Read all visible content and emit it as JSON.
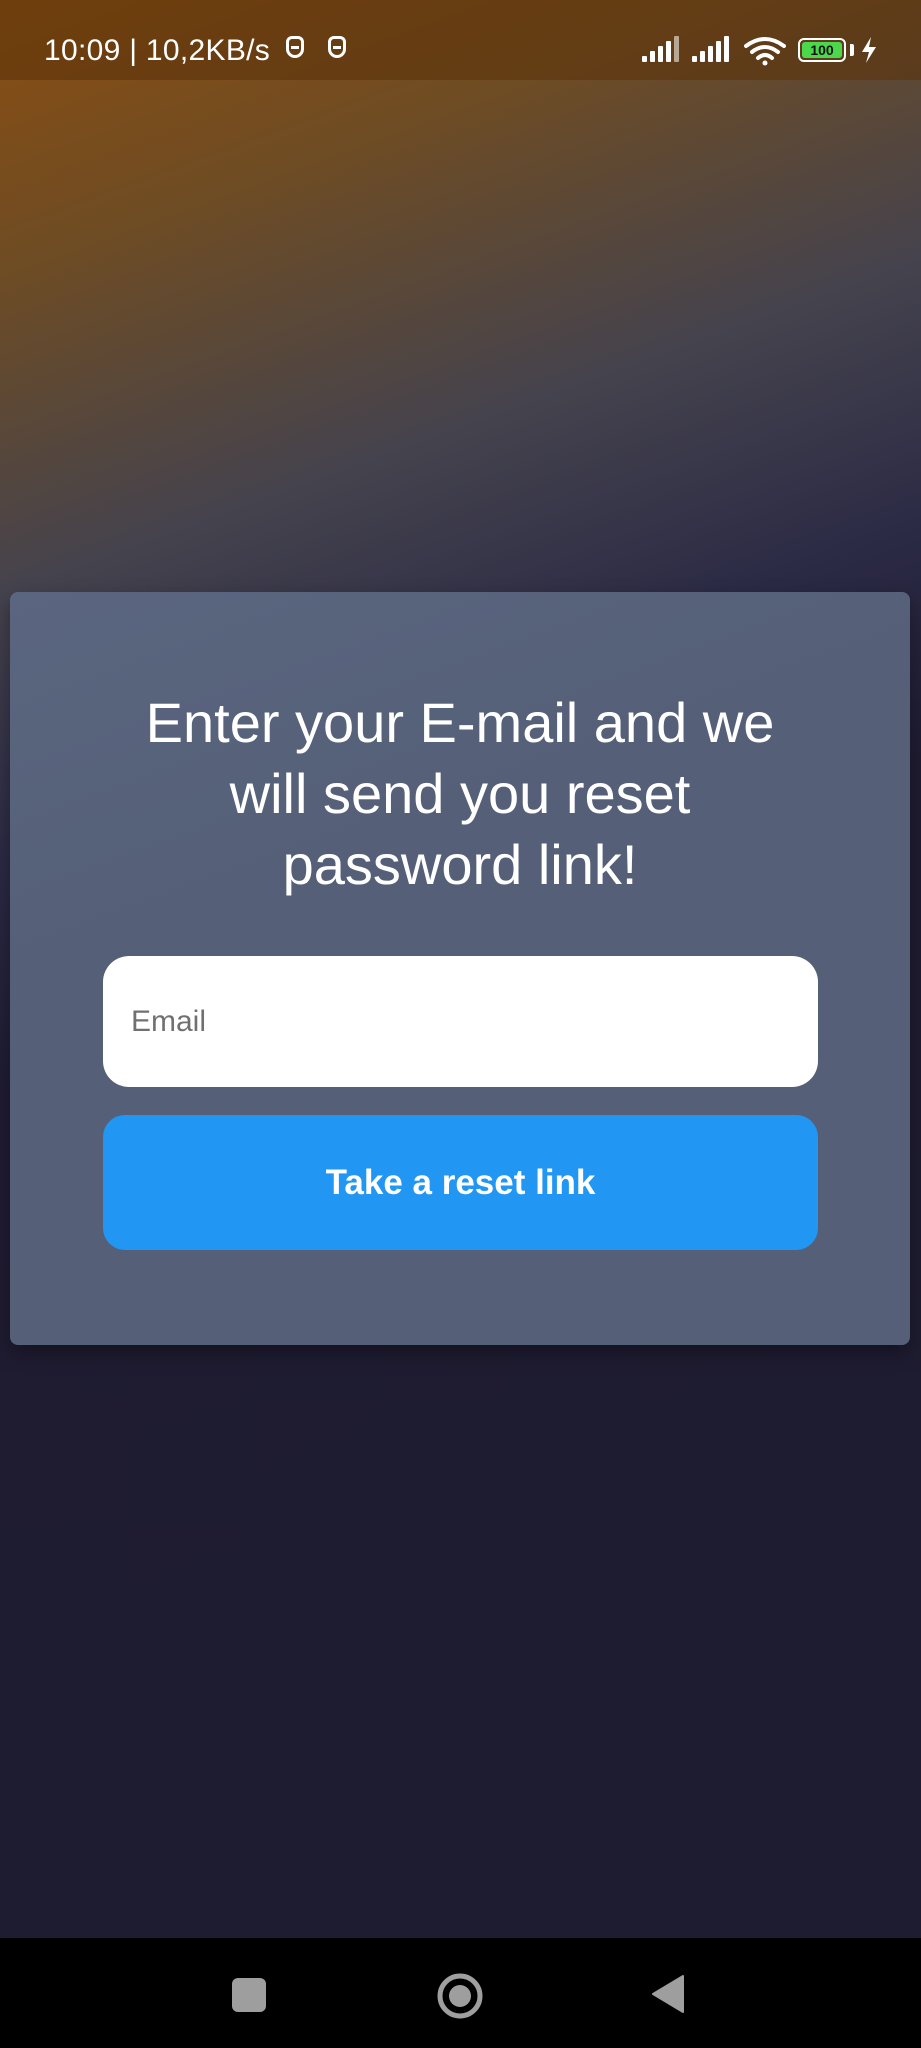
{
  "status_bar": {
    "time_speed": "10:09 | 10,2KB/s",
    "battery_level": "100",
    "icons": [
      "notification-icon",
      "notification-icon",
      "signal-icon",
      "signal-icon",
      "wifi-icon",
      "battery-icon",
      "charging-icon"
    ]
  },
  "reset_card": {
    "title": "Enter your E-mail and we will send you reset password link!",
    "email_placeholder": "Email",
    "email_value": "",
    "button_label": "Take a reset link"
  },
  "nav_bar": {
    "icons": [
      "recents-icon",
      "home-icon",
      "back-icon"
    ]
  },
  "colors": {
    "card": "#556078",
    "button": "#2196f3",
    "background_dark": "#1e1c30",
    "background_accent": "#8a4e12"
  }
}
